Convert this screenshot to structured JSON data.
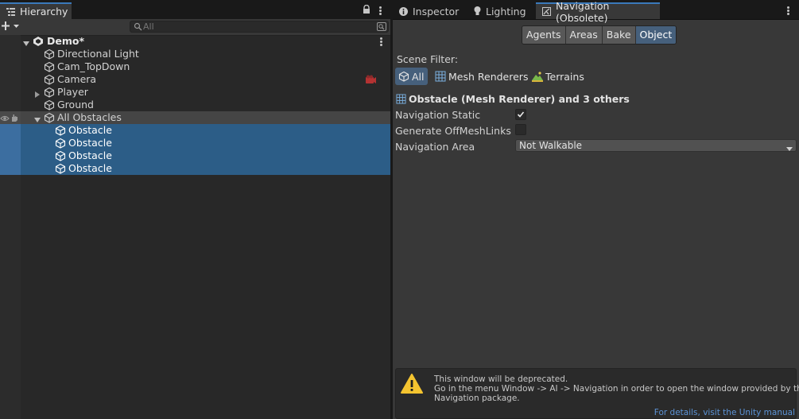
{
  "hierarchy": {
    "tab_label": "Hierarchy",
    "search_placeholder": "All",
    "scene_name": "Demo*",
    "items": [
      {
        "label": "Directional Light"
      },
      {
        "label": "Cam_TopDown"
      },
      {
        "label": "Camera"
      },
      {
        "label": "Player"
      },
      {
        "label": "Ground"
      },
      {
        "label": "All Obstacles"
      },
      {
        "label": "Obstacle"
      },
      {
        "label": "Obstacle"
      },
      {
        "label": "Obstacle"
      },
      {
        "label": "Obstacle"
      }
    ]
  },
  "tabs": {
    "inspector": "Inspector",
    "lighting": "Lighting",
    "navigation": "Navigation (Obsolete)"
  },
  "navigation": {
    "segments": [
      "Agents",
      "Areas",
      "Bake",
      "Object"
    ],
    "selected_segment": "Object",
    "scene_filter_label": "Scene Filter:",
    "filters": [
      "All",
      "Mesh Renderers",
      "Terrains"
    ],
    "selected_filter": "All",
    "selection_header": "Obstacle (Mesh Renderer) and 3 others",
    "fields": {
      "navigation_static": {
        "label": "Navigation Static",
        "checked": true
      },
      "generate_offmeshlinks": {
        "label": "Generate OffMeshLinks",
        "checked": false
      },
      "navigation_area": {
        "label": "Navigation Area",
        "value": "Not Walkable"
      }
    },
    "help": {
      "line1": "This window will be deprecated.",
      "line2": "Go in the menu Window -> AI -> Navigation in order to open the window provided by the AI",
      "line3": "Navigation package."
    },
    "link": "For details, visit the Unity manual"
  },
  "colors": {
    "selection": "#2c5d87",
    "accent": "#3a79bb",
    "warning": "#f4c430",
    "link": "#5c93d6"
  },
  "icons": [
    "hierarchy-icon",
    "lock-icon",
    "search-icon",
    "gameobject-cube-icon",
    "info-icon",
    "lightbulb-icon",
    "navigation-icon",
    "mesh-renderer-icon",
    "terrain-icon",
    "warning-icon",
    "kebab-menu-icon"
  ]
}
